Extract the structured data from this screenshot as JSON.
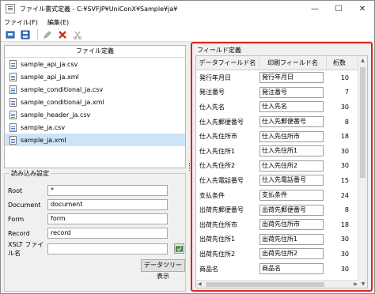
{
  "window": {
    "title": "ファイル書式定義 - C:¥SVFJP¥UniConX¥Sample¥ja¥",
    "minimize": "—",
    "maximize": "☐",
    "close": "✕"
  },
  "menu": {
    "file": "ファイル(F)",
    "edit": "編集(E)"
  },
  "toolbar": {
    "icons": [
      "open-icon",
      "save-icon",
      "edit-icon",
      "delete-icon",
      "cut-icon"
    ]
  },
  "file_list": {
    "header": "ファイル定義",
    "items": [
      "sample_api_ja.csv",
      "sample_api_ja.xml",
      "sample_conditional_ja.csv",
      "sample_conditional_ja.xml",
      "sample_header_ja.csv",
      "sample_ja.csv",
      "sample_ja.xml"
    ],
    "selected": "sample_ja.xml"
  },
  "read_settings": {
    "title": "読み込み設定",
    "root_label": "Root",
    "root_value": "*",
    "document_label": "Document",
    "document_value": "document",
    "form_label": "Form",
    "form_value": "form",
    "record_label": "Record",
    "record_value": "record",
    "xslt_label": "XSLT ファイル名",
    "xslt_value": "",
    "tree_button": "データツリー表示"
  },
  "field_definition": {
    "title": "フィールド定義",
    "columns": [
      "データフィールド名",
      "印刷フィールド名",
      "桁数"
    ],
    "rows": [
      {
        "data": "発行年月日",
        "print": "発行年月日",
        "digits": "10"
      },
      {
        "data": "発注番号",
        "print": "発注番号",
        "digits": "7"
      },
      {
        "data": "仕入先名",
        "print": "仕入先名",
        "digits": "30"
      },
      {
        "data": "仕入先郵便番号",
        "print": "仕入先郵便番号",
        "digits": "8"
      },
      {
        "data": "仕入先住所市",
        "print": "仕入先住所市",
        "digits": "18"
      },
      {
        "data": "仕入先住所1",
        "print": "仕入先住所1",
        "digits": "30"
      },
      {
        "data": "仕入先住所2",
        "print": "仕入先住所2",
        "digits": "30"
      },
      {
        "data": "仕入先電話番号",
        "print": "仕入先電話番号",
        "digits": "15"
      },
      {
        "data": "支払条件",
        "print": "支払条件",
        "digits": "24"
      },
      {
        "data": "出荷先郵便番号",
        "print": "出荷先郵便番号",
        "digits": "8"
      },
      {
        "data": "出荷先住所市",
        "print": "出荷先住所市",
        "digits": "18"
      },
      {
        "data": "出荷先住所1",
        "print": "出荷先住所1",
        "digits": "30"
      },
      {
        "data": "出荷先住所2",
        "print": "出荷先住所2",
        "digits": "30"
      },
      {
        "data": "商品名",
        "print": "商品名",
        "digits": "30"
      }
    ]
  },
  "colors": {
    "highlight_border": "#d9261c",
    "selected_row": "#cce4f7"
  }
}
